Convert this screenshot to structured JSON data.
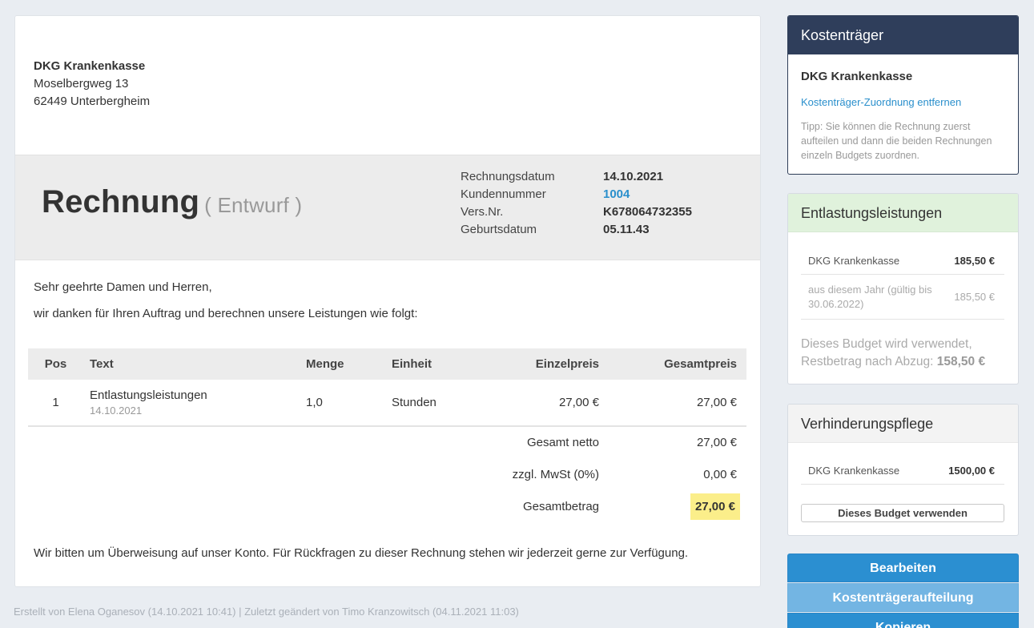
{
  "invoice": {
    "address": {
      "name": "DKG Krankenkasse",
      "street": "Moselbergweg 13",
      "city": "62449 Unterbergheim"
    },
    "title": "Rechnung",
    "status": "( Entwurf )",
    "meta": [
      {
        "key": "Rechnungsdatum",
        "value": "14.10.2021"
      },
      {
        "key": "Kundennummer",
        "value": "1004"
      },
      {
        "key": "Vers.Nr.",
        "value": "K678064732355"
      },
      {
        "key": "Geburtsdatum",
        "value": "05.11.43"
      }
    ],
    "greeting": "Sehr geehrte Damen und Herren,",
    "intro": "wir danken für Ihren Auftrag und berechnen unsere Leistungen wie folgt:",
    "columns": {
      "pos": "Pos",
      "text": "Text",
      "menge": "Menge",
      "einheit": "Einheit",
      "einzelpreis": "Einzelpreis",
      "gesamtpreis": "Gesamtpreis"
    },
    "items": [
      {
        "pos": "1",
        "text": "Entlastungsleistungen",
        "date": "14.10.2021",
        "menge": "1,0",
        "einheit": "Stunden",
        "einzelpreis": "27,00 €",
        "gesamtpreis": "27,00 €"
      }
    ],
    "totals": {
      "netto_label": "Gesamt netto",
      "netto": "27,00 €",
      "mwst_label": "zzgl. MwSt (0%)",
      "mwst": "0,00 €",
      "gesamt_label": "Gesamtbetrag",
      "gesamt": "27,00 €"
    },
    "closing": "Wir bitten um Überweisung auf unser Konto. Für Rückfragen zu dieser Rechnung stehen wir jederzeit gerne zur Verfügung."
  },
  "footer": "Erstellt von Elena Oganesov (14.10.2021 10:41) | Zuletzt geändert von Timo Kranzowitsch (04.11.2021 11:03)",
  "sidebar": {
    "kostentraeger": {
      "title": "Kostenträger",
      "name": "DKG Krankenkasse",
      "remove_link": "Kostenträger-Zuordnung entfernen",
      "tip": "Tipp: Sie können die Rechnung zuerst aufteilen und dann die beiden Rechnungen einzeln Budgets zuordnen."
    },
    "entlastung": {
      "title": "Entlastungsleistungen",
      "rows": [
        {
          "label": "DKG Krankenkasse",
          "amount": "185,50 €"
        },
        {
          "label": "aus diesem Jahr (gültig bis 30.06.2022)",
          "amount": "185,50 €"
        }
      ],
      "note": "Dieses Budget wird verwendet, Restbetrag nach Abzug:",
      "rest": "158,50 €"
    },
    "verhinderung": {
      "title": "Verhinderungspflege",
      "rows": [
        {
          "label": "DKG Krankenkasse",
          "amount": "1500,00 €"
        }
      ],
      "button": "Dieses Budget verwenden"
    },
    "actions": {
      "edit": "Bearbeiten",
      "split": "Kostenträgeraufteilung",
      "copy": "Kopieren"
    }
  },
  "colors": {
    "navy_header": "#2f3e5b",
    "green_header": "#e0f2dc",
    "primary_button": "#2b8fd1",
    "highlight_total": "#fbee8a",
    "link": "#2a8fcc"
  }
}
